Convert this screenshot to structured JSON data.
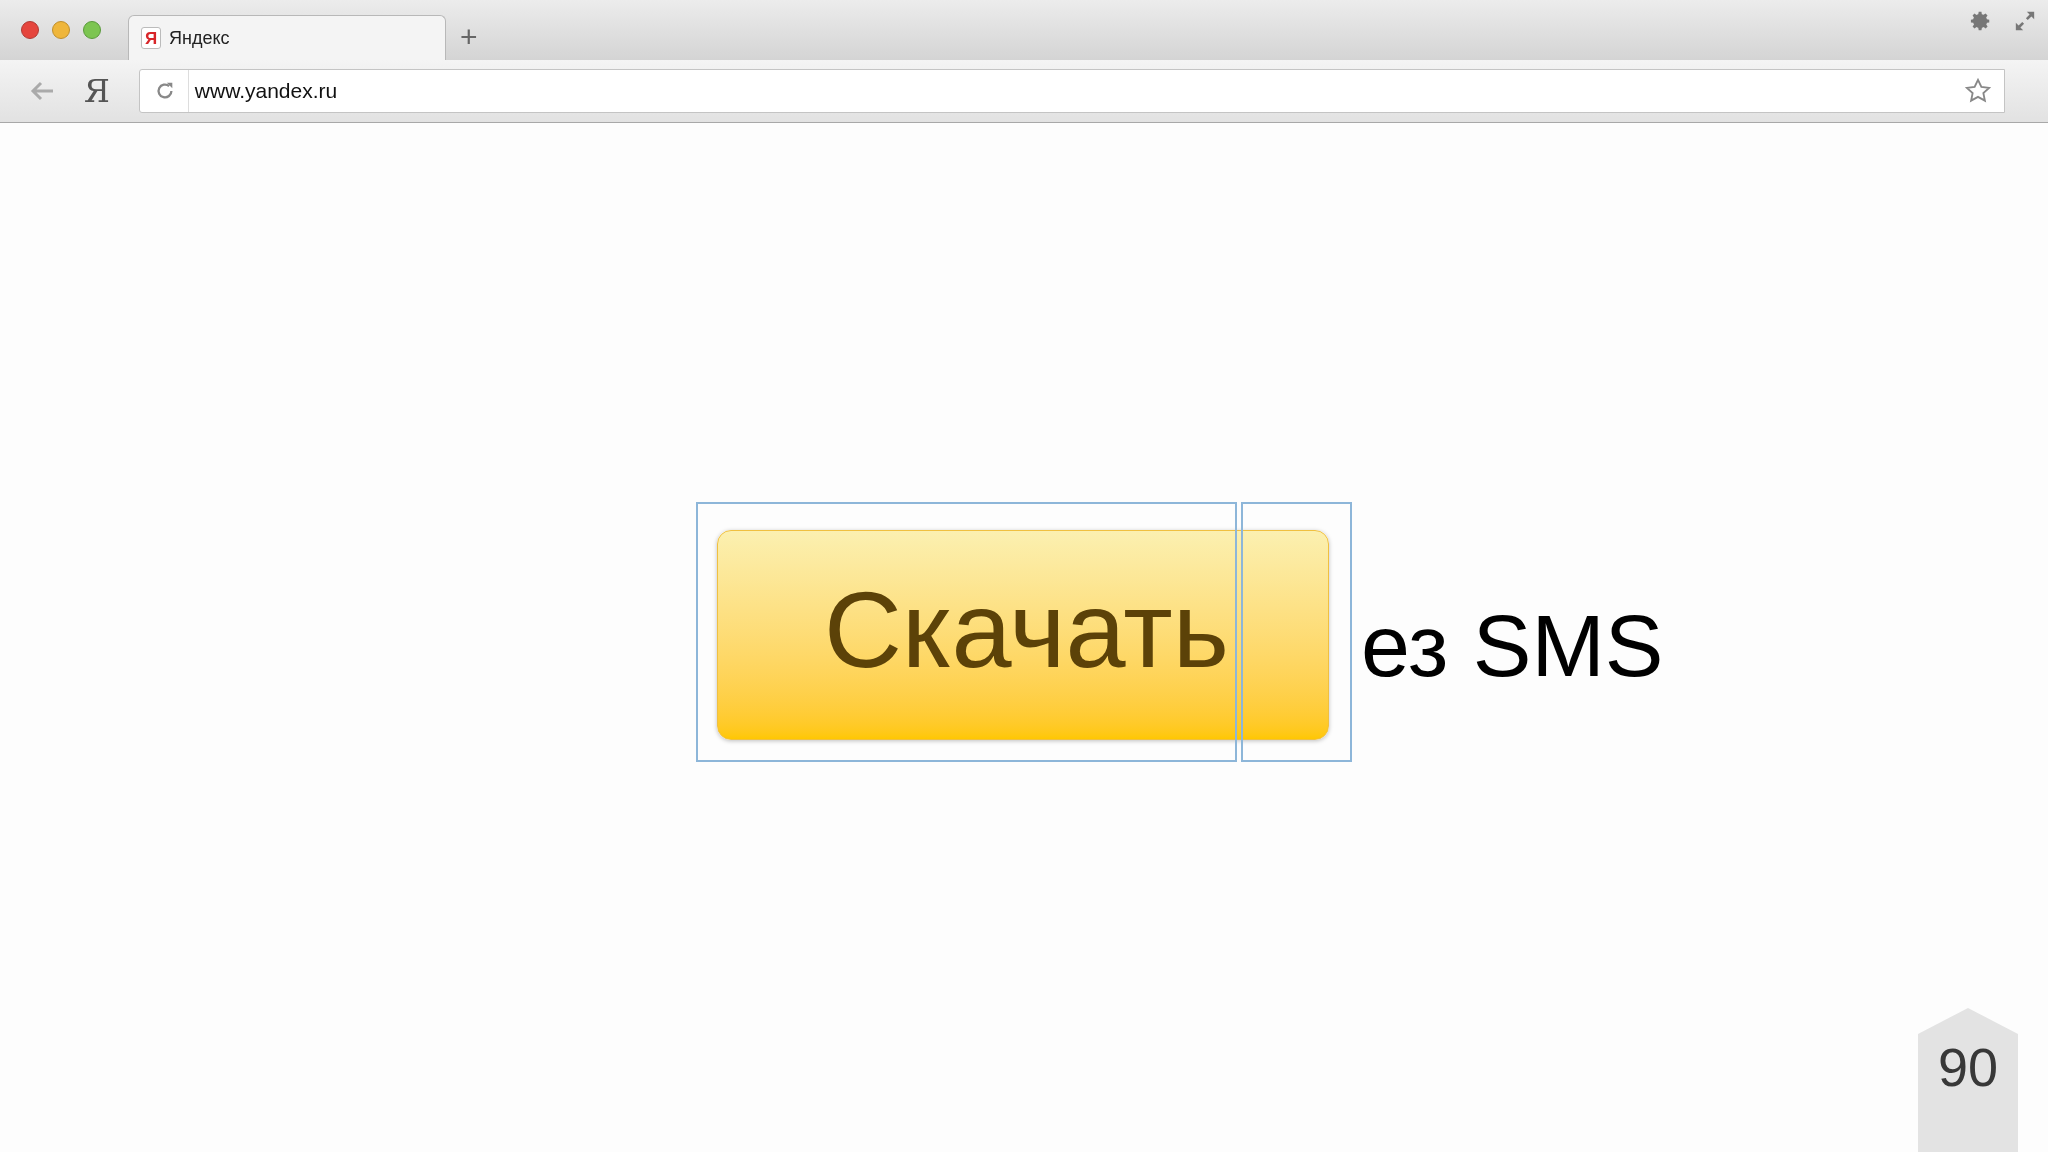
{
  "browser": {
    "tabs": [
      {
        "favicon": "Я",
        "title": "Яндекс",
        "selected": true
      }
    ],
    "new_tab": "+",
    "home_button": "Я",
    "address": "www.yandex.ru"
  },
  "page": {
    "button": "Скачать",
    "text": "ез SMS"
  },
  "slide_number": "90"
}
